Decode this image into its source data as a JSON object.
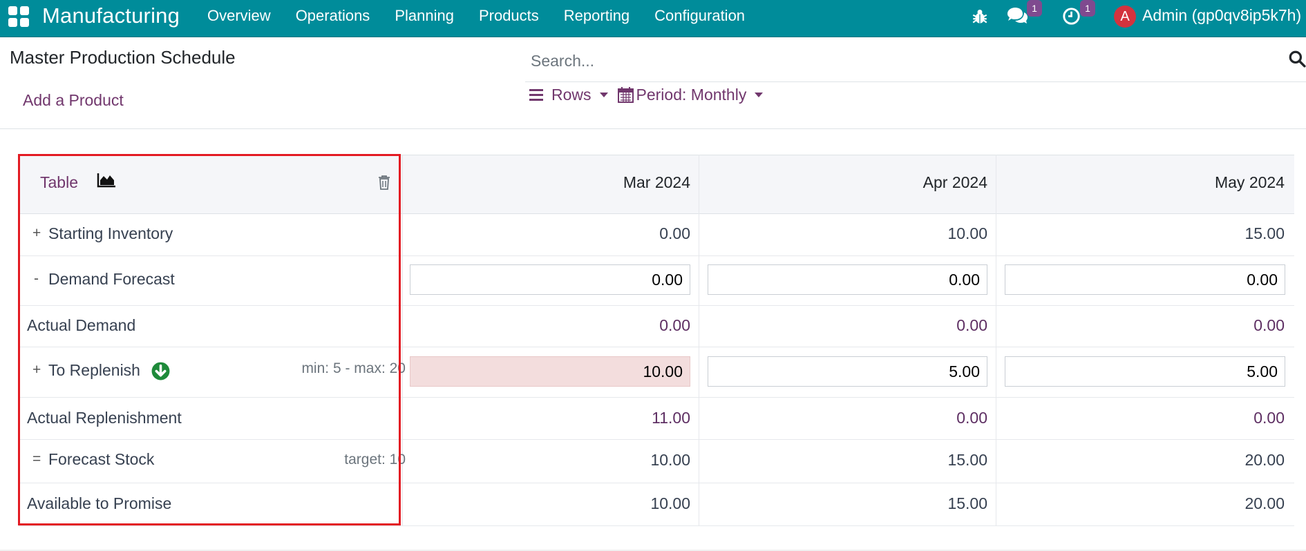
{
  "navbar": {
    "app_name": "Manufacturing",
    "menu": [
      "Overview",
      "Operations",
      "Planning",
      "Products",
      "Reporting",
      "Configuration"
    ],
    "messages_badge": "1",
    "activities_badge": "1",
    "avatar_letter": "A",
    "user_name": "Admin (gp0qv8ip5k7h)",
    "color": "#008c9a"
  },
  "control_panel": {
    "title": "Master Production Schedule",
    "add_product": "Add a Product",
    "search_placeholder": "Search...",
    "rows_label": "Rows",
    "period_label": "Period: Monthly"
  },
  "table": {
    "table_label": "Table",
    "columns": [
      "Mar 2024",
      "Apr 2024",
      "May 2024"
    ],
    "rows": [
      {
        "sign": "+",
        "label": "Starting Inventory",
        "extra": "",
        "values": [
          "0.00",
          "10.00",
          "15.00"
        ]
      },
      {
        "sign": "-",
        "label": "Demand Forecast",
        "extra": "",
        "values": [
          "0.00",
          "0.00",
          "0.00"
        ]
      },
      {
        "sign": "",
        "label": "Actual Demand",
        "extra": "",
        "values": [
          "0.00",
          "0.00",
          "0.00"
        ]
      },
      {
        "sign": "+",
        "label": "To Replenish",
        "extra": "min: 5 - max: 20",
        "values": [
          "10.00",
          "5.00",
          "5.00"
        ]
      },
      {
        "sign": "",
        "label": "Actual Replenishment",
        "extra": "",
        "values": [
          "11.00",
          "0.00",
          "0.00"
        ]
      },
      {
        "sign": "=",
        "label": "Forecast Stock",
        "extra": "target: 10",
        "values": [
          "10.00",
          "15.00",
          "20.00"
        ]
      },
      {
        "sign": "",
        "label": "Available to Promise",
        "extra": "",
        "values": [
          "10.00",
          "15.00",
          "20.00"
        ]
      }
    ]
  }
}
